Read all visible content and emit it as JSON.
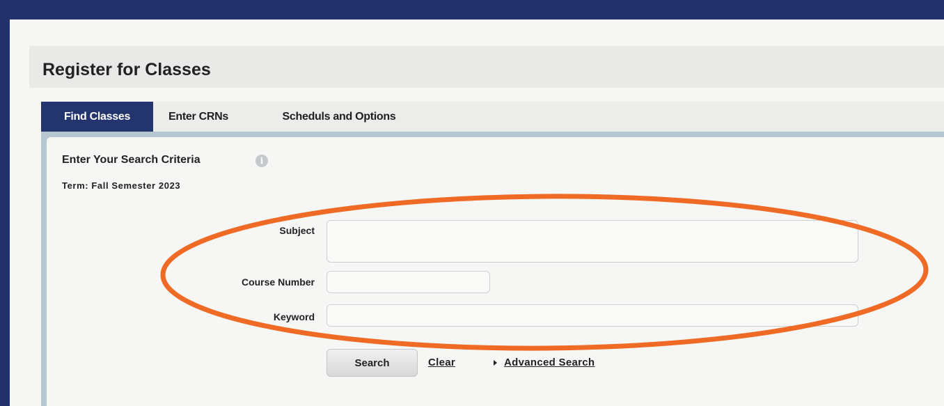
{
  "page": {
    "title": "Register for Classes"
  },
  "tabs": [
    {
      "label": "Find Classes",
      "active": true
    },
    {
      "label": "Enter CRNs",
      "active": false
    },
    {
      "label": "Scheduls and Options",
      "active": false
    }
  ],
  "search": {
    "heading": "Enter  Your Search Criteria",
    "term": "Term: Fall Semester 2023",
    "fields": {
      "subject": {
        "label": "Subject",
        "value": ""
      },
      "course_number": {
        "label": "Course Number",
        "value": ""
      },
      "keyword": {
        "label": "Keyword",
        "value": ""
      }
    },
    "buttons": {
      "search": "Search",
      "clear": "Clear",
      "advanced": "Advanced Search"
    }
  },
  "icons": {
    "info": "info-icon",
    "advanced_toggle": "caret-right-icon"
  },
  "colors": {
    "brand": "#23326b",
    "active_tab": "#24346d",
    "highlight": "#ef6a24"
  }
}
